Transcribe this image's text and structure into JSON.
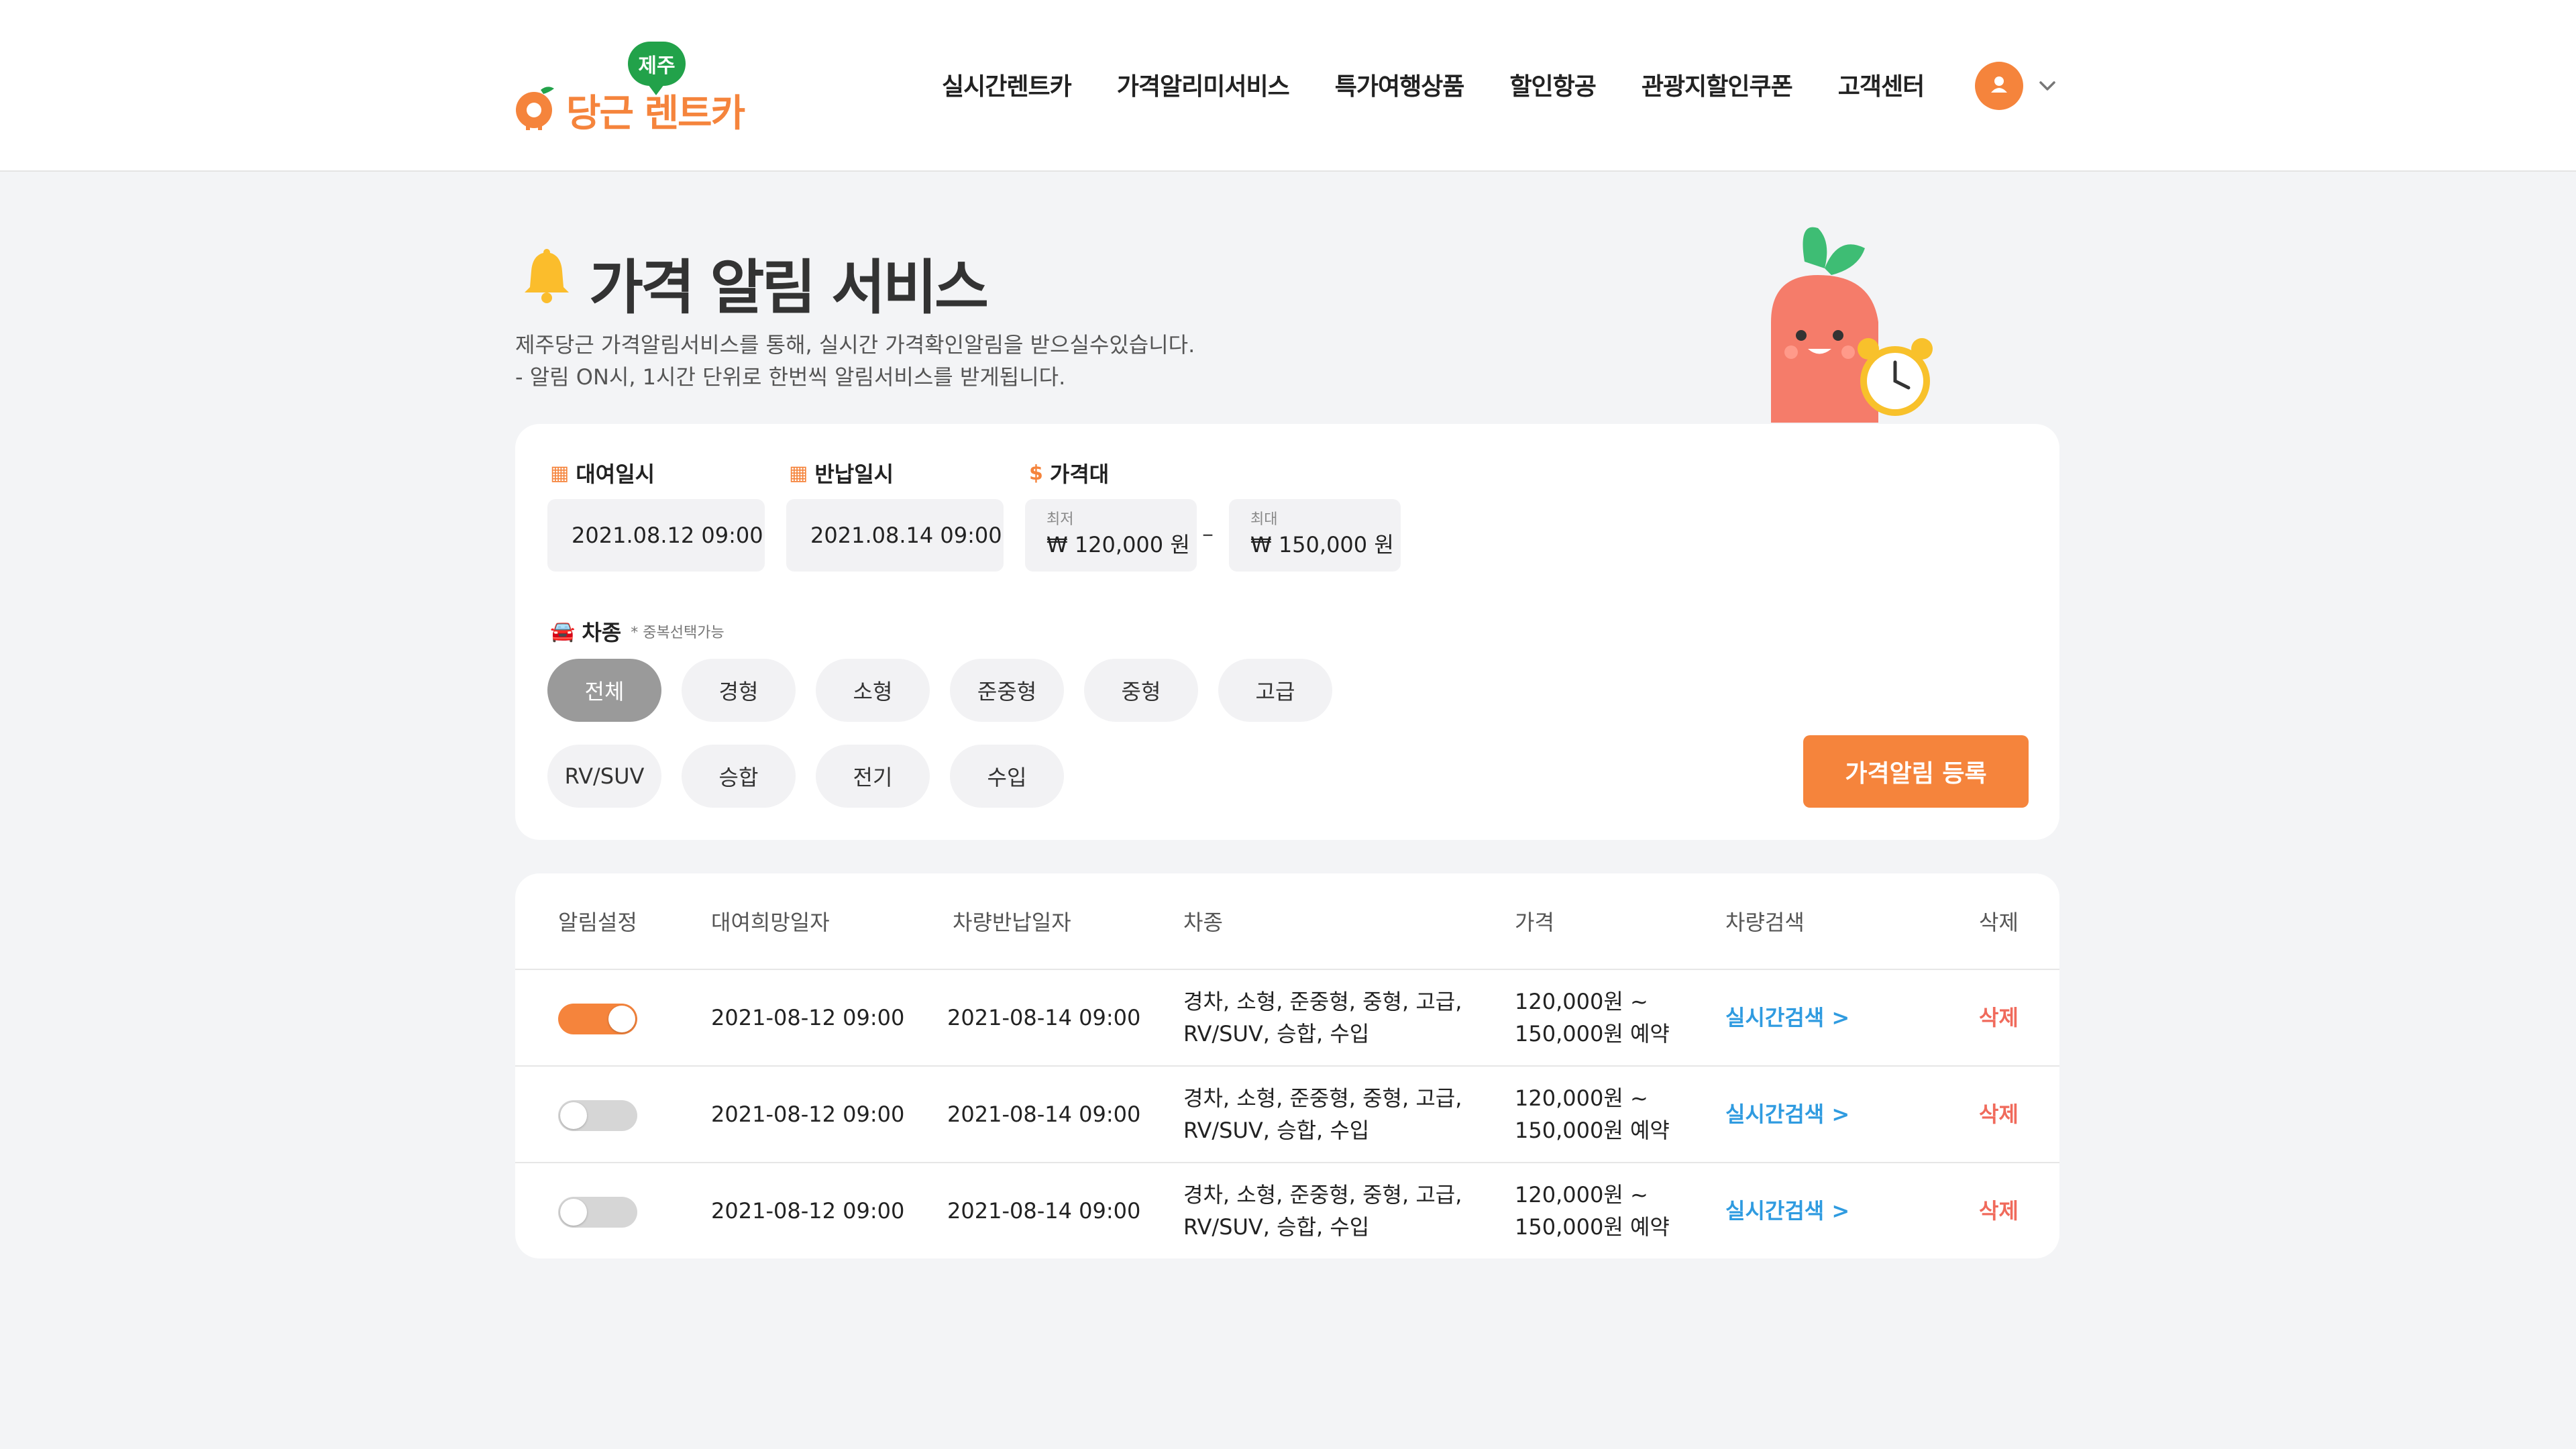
{
  "header": {
    "logo_badge": "제주",
    "logo_text": "당근 렌트카",
    "nav": [
      "실시간렌트카",
      "가격알리미서비스",
      "특가여행상품",
      "할인항공",
      "관광지할인쿠폰",
      "고객센터"
    ]
  },
  "page": {
    "title": "가격 알림 서비스",
    "desc_line1": "제주당근 가격알림서비스를 통해, 실시간 가격확인알림을 받으실수있습니다.",
    "desc_line2": "- 알림 ON시, 1시간 단위로 한번씩 알림서비스를 받게됩니다."
  },
  "filter": {
    "rent_label": "대여일시",
    "rent_value": "2021.08.12    09:00",
    "return_label": "반납일시",
    "return_value": "2021.08.14    09:00",
    "price_label": "가격대",
    "price_min_caption": "최저",
    "price_min_value": "₩ 120,000 원",
    "price_max_caption": "최대",
    "price_max_value": "₩ 150,000 원",
    "price_dash": "–",
    "car_label": "차종",
    "car_note": "* 중복선택가능",
    "car_types": [
      "전체",
      "경형",
      "소형",
      "준중형",
      "중형",
      "고급",
      "RV/SUV",
      "승합",
      "전기",
      "수입"
    ],
    "active_car_type": "전체",
    "register_button": "가격알림 등록"
  },
  "table": {
    "headers": [
      "알림설정",
      "대여희망일자",
      "차량반납일자",
      "차종",
      "가격",
      "차량검색",
      "삭제"
    ],
    "rows": [
      {
        "alert_on": true,
        "rent_date": "2021-08-12 09:00",
        "return_date": "2021-08-14 09:00",
        "car_line1": "경차, 소형, 준중형, 중형, 고급,",
        "car_line2": "RV/SUV, 승합, 수입",
        "price_line1": "120,000원 ~",
        "price_line2": "150,000원 예약",
        "search": "실시간검색 >",
        "delete": "삭제"
      },
      {
        "alert_on": false,
        "rent_date": "2021-08-12 09:00",
        "return_date": "2021-08-14 09:00",
        "car_line1": "경차, 소형, 준중형, 중형, 고급,",
        "car_line2": "RV/SUV, 승합, 수입",
        "price_line1": "120,000원 ~",
        "price_line2": "150,000원 예약",
        "search": "실시간검색 >",
        "delete": "삭제"
      },
      {
        "alert_on": false,
        "rent_date": "2021-08-12 09:00",
        "return_date": "2021-08-14 09:00",
        "car_line1": "경차, 소형, 준중형, 중형, 고급,",
        "car_line2": "RV/SUV, 승합, 수입",
        "price_line1": "120,000원 ~",
        "price_line2": "150,000원 예약",
        "search": "실시간검색 >",
        "delete": "삭제"
      }
    ]
  },
  "colors": {
    "accent": "#f5843c",
    "green": "#22a24a",
    "link": "#2f9be0",
    "delete": "#f06a5b",
    "background": "#f3f4f6"
  },
  "icons": [
    "carrot-logo-icon",
    "user-icon",
    "chevron-down-icon",
    "bell-icon",
    "calendar-icon",
    "dollar-icon",
    "car-icon",
    "carrot-alarm-mascot"
  ]
}
